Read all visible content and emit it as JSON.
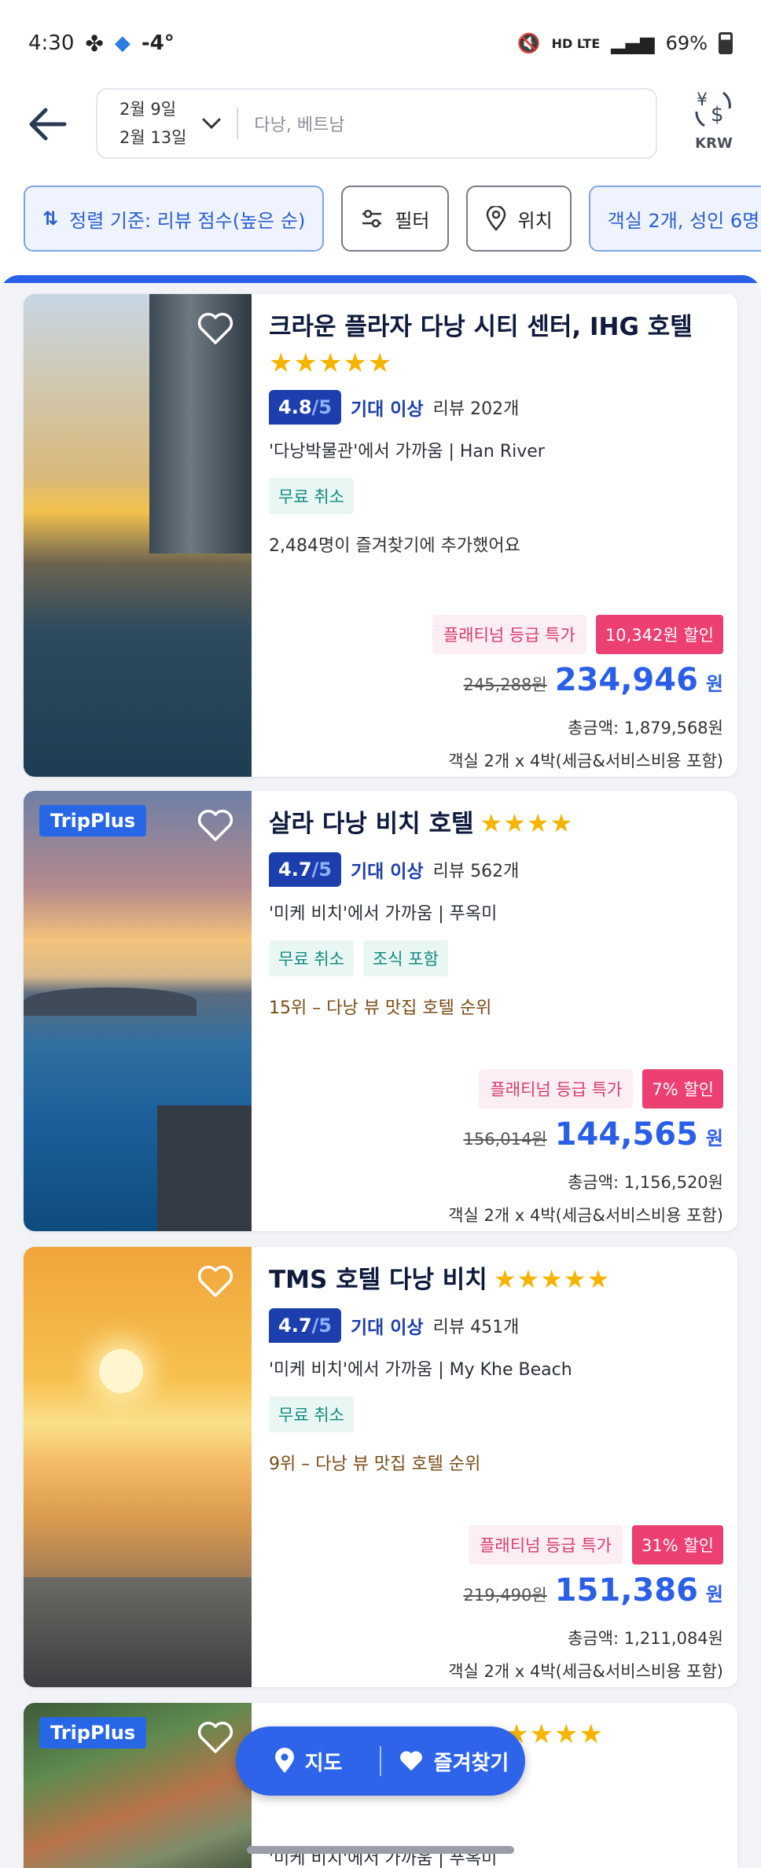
{
  "status": {
    "time": "4:30",
    "temp": "-4°",
    "network": "HD LTE",
    "battery": "69%"
  },
  "search": {
    "date_from": "2월 9일",
    "date_to": "2월 13일",
    "destination": "다낭, 베트남"
  },
  "currency": {
    "code": "KRW"
  },
  "chips": {
    "sort": "정렬 기준: 리뷰 점수(높은 순)",
    "filter": "필터",
    "location": "위치",
    "rooms": "객실 2개, 성인 6명"
  },
  "hotels": [
    {
      "name": "크라운 플라자 다낭 시티 센터, IHG 호텔",
      "stars": "★★★★★",
      "score": "4.8",
      "score_den": "/5",
      "grade": "기대 이상",
      "reviews": "리뷰 202개",
      "near": "'다낭박물관'에서 가까움 | Han River",
      "tags": [
        "무료 취소"
      ],
      "extra": "2,484명이 즐겨찾기에 추가했어요",
      "promo": "플래티넘 등급 특가",
      "discount": "10,342원 할인",
      "original": "245,288원",
      "price": "234,946",
      "won": "원",
      "total": "총금액: 1,879,568원",
      "per": "객실 2개 x 4박(세금&서비스비용 포함)"
    },
    {
      "badge": "TripPlus",
      "name": "살라 다낭 비치 호텔",
      "stars": "★★★★",
      "score": "4.7",
      "score_den": "/5",
      "grade": "기대 이상",
      "reviews": "리뷰 562개",
      "near": "'미케 비치'에서 가까움 | 푸옥미",
      "tags": [
        "무료 취소",
        "조식 포함"
      ],
      "extra": "15위 – 다낭 뷰 맛집 호텔 순위",
      "promo": "플래티넘 등급 특가",
      "discount": "7% 할인",
      "original": "156,014원",
      "price": "144,565",
      "won": "원",
      "total": "총금액: 1,156,520원",
      "per": "객실 2개 x 4박(세금&서비스비용 포함)"
    },
    {
      "name": "TMS 호텔 다낭 비치",
      "stars": "★★★★★",
      "score": "4.7",
      "score_den": "/5",
      "grade": "기대 이상",
      "reviews": "리뷰 451개",
      "near": "'미케 비치'에서 가까움 | My Khe Beach",
      "tags": [
        "무료 취소"
      ],
      "extra": "9위 – 다낭 뷰 맛집 호텔 순위",
      "promo": "플래티넘 등급 특가",
      "discount": "31% 할인",
      "original": "219,490원",
      "price": "151,386",
      "won": "원",
      "total": "총금액: 1,211,084원",
      "per": "객실 2개 x 4박(세금&서비스비용 포함)"
    },
    {
      "badge": "TripPlus",
      "stars": "★★★★",
      "near": "'미케 비치'에서 가까움 | 푸옥미"
    }
  ],
  "bottom": {
    "map": "지도",
    "favorites": "즐겨찾기"
  },
  "colors": {
    "accent": "#2b5fe8",
    "score": "#1d3fae",
    "discount": "#ec3f72",
    "star": "#f6b400"
  }
}
